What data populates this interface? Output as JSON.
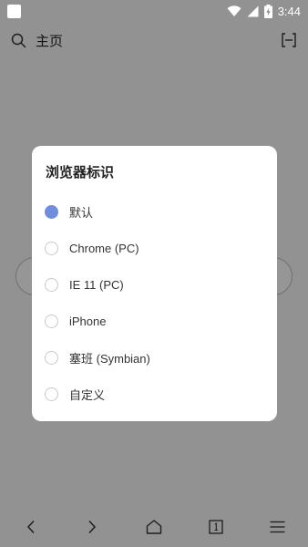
{
  "status_bar": {
    "time": "3:44"
  },
  "top_bar": {
    "title": "主页"
  },
  "dialog": {
    "title": "浏览器标识",
    "options": [
      {
        "label": "默认",
        "selected": true
      },
      {
        "label": "Chrome (PC)",
        "selected": false
      },
      {
        "label": "IE 11 (PC)",
        "selected": false
      },
      {
        "label": "iPhone",
        "selected": false
      },
      {
        "label": "塞班 (Symbian)",
        "selected": false
      },
      {
        "label": "自定义",
        "selected": false
      }
    ]
  },
  "colors": {
    "accent": "#6f8fdc",
    "scrim": "rgba(0,0,0,0.40)"
  },
  "icons": {
    "status_left": "app-square-icon",
    "wifi": "wifi-icon",
    "signal": "signal-icon",
    "battery": "battery-charging-icon",
    "search": "search-icon",
    "scan": "scan-icon",
    "back": "chevron-left-icon",
    "forward": "chevron-right-icon",
    "home": "home-icon",
    "tabs": "tabs-icon",
    "menu": "menu-icon"
  }
}
